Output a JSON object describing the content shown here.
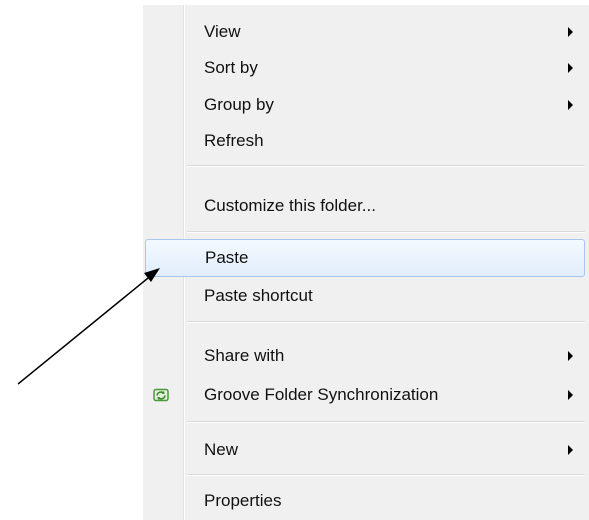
{
  "context_menu": {
    "items": [
      {
        "label": "View",
        "submenu": true
      },
      {
        "label": "Sort by",
        "submenu": true
      },
      {
        "label": "Group by",
        "submenu": true
      },
      {
        "label": "Refresh",
        "submenu": false
      },
      {
        "label": "Customize this folder...",
        "submenu": false
      },
      {
        "label": "Paste",
        "submenu": false,
        "highlighted": true
      },
      {
        "label": "Paste shortcut",
        "submenu": false
      },
      {
        "label": "Share with",
        "submenu": true
      },
      {
        "label": "Groove Folder Synchronization",
        "submenu": true,
        "icon": "groove-sync-icon"
      },
      {
        "label": "New",
        "submenu": true
      },
      {
        "label": "Properties",
        "submenu": false
      }
    ]
  },
  "colors": {
    "menu_background": "#f0f0f0",
    "highlight_border": "#a9c6ee",
    "highlight_fill": "#e2eefc",
    "groove_icon": "#4a9a3a"
  },
  "annotation": {
    "icon": "pointer-arrow-icon",
    "points_to": "Paste"
  }
}
